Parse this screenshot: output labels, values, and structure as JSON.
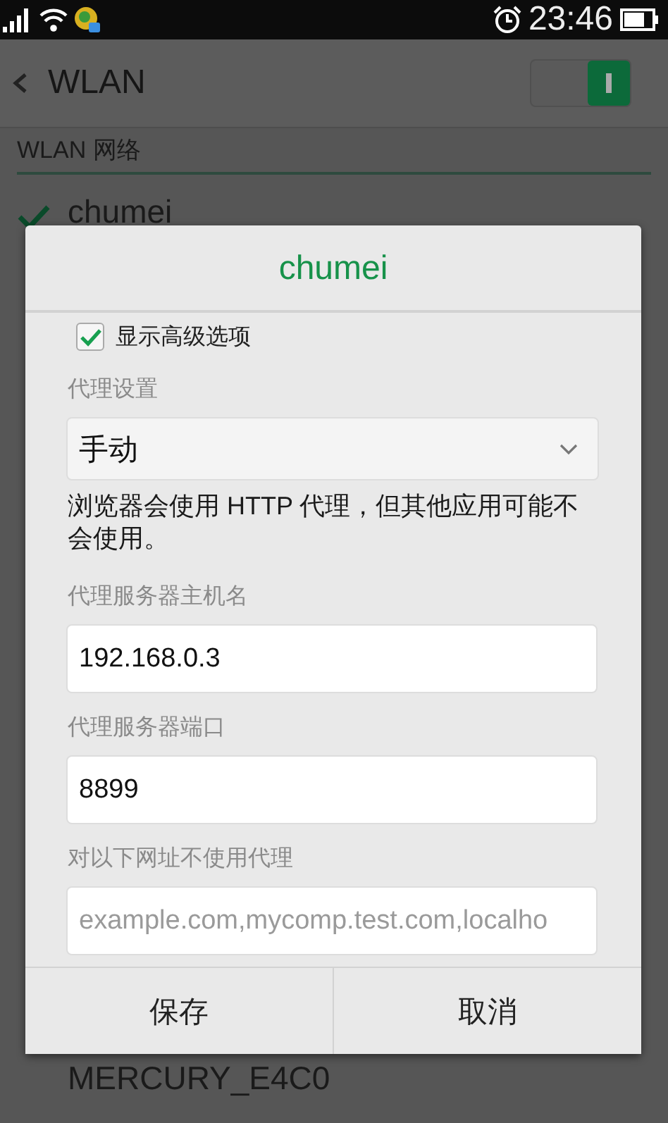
{
  "status_bar": {
    "time": "23:46"
  },
  "header": {
    "title": "WLAN",
    "wlan_on": true
  },
  "section_title": "WLAN 网络",
  "networks": [
    {
      "name": "chumei",
      "connected": true
    },
    {
      "name": "MERCURY_E4C0",
      "connected": false
    }
  ],
  "dialog": {
    "title": "chumei",
    "advanced": {
      "label": "显示高级选项",
      "checked": true
    },
    "fields": [
      {
        "kind": "select",
        "label": "代理设置",
        "value": "手动"
      },
      {
        "kind": "note",
        "text": "浏览器会使用 HTTP 代理，但其他应用可能不会使用。"
      },
      {
        "kind": "input",
        "label": "代理服务器主机名",
        "value": "192.168.0.3"
      },
      {
        "kind": "input",
        "label": "代理服务器端口",
        "value": "8899"
      },
      {
        "kind": "input",
        "label": "对以下网址不使用代理",
        "placeholder": "example.com,mycomp.test.com,localho"
      }
    ],
    "buttons": [
      "保存",
      "取消"
    ]
  }
}
